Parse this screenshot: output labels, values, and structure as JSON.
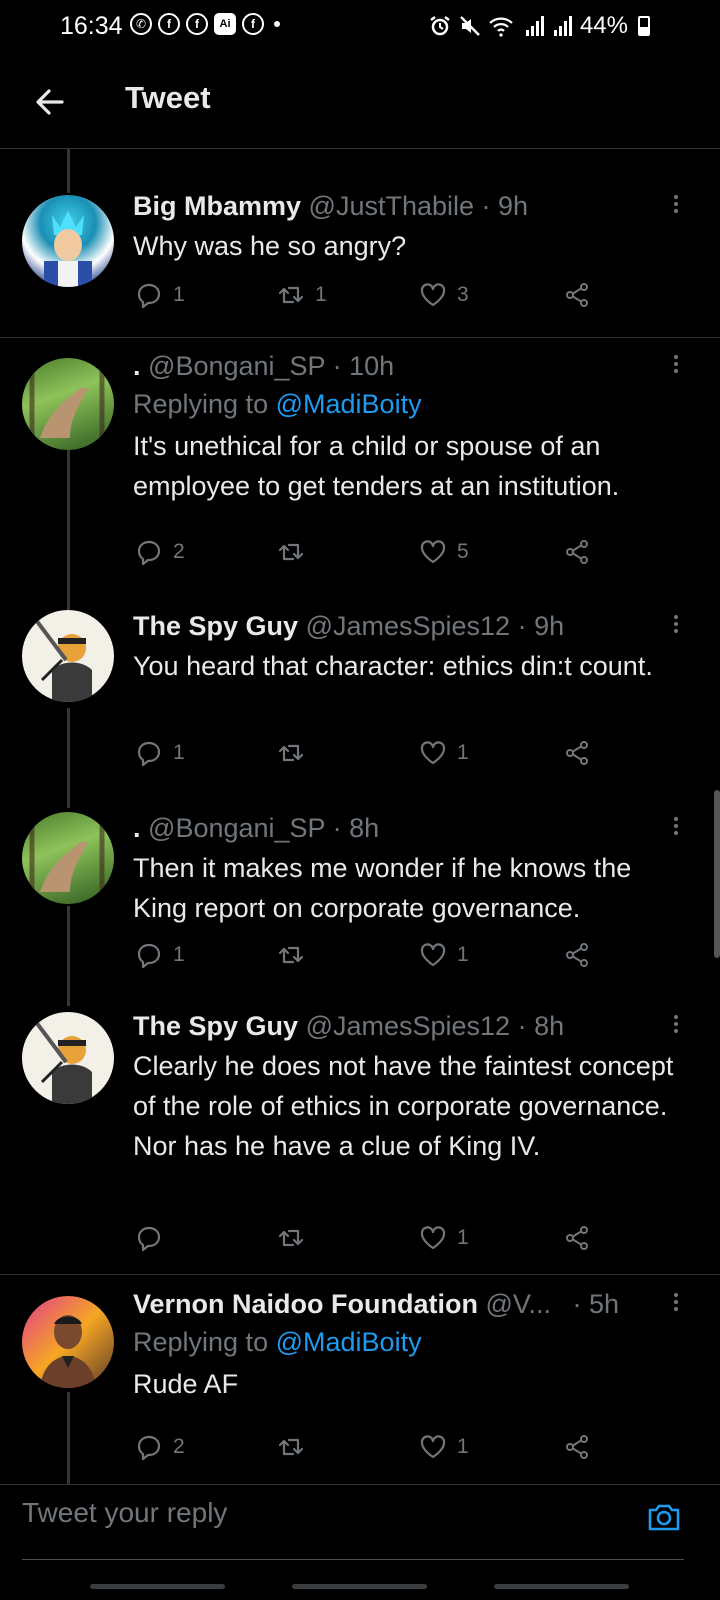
{
  "status_bar": {
    "time": "16:34",
    "app_icons": [
      "whatsapp-icon",
      "facebook-icon",
      "facebook-icon",
      "ai-icon",
      "facebook-icon"
    ],
    "ai_label": "Ai",
    "battery": "44%"
  },
  "header": {
    "title": "Tweet"
  },
  "tweets": [
    {
      "name": "Big Mbammy",
      "handle": "@JustThabile",
      "time": "· 9h",
      "reply_to_prefix": "",
      "reply_to": "",
      "text": "Why was he so angry?",
      "replies": "1",
      "retweets": "1",
      "likes": "3"
    },
    {
      "name": ".",
      "handle": "@Bongani_SP",
      "time": "· 10h",
      "reply_to_prefix": "Replying to",
      "reply_to": "@MadiBoity",
      "text": "It's unethical for a child or spouse of an employee to get tenders at an institution.",
      "replies": "2",
      "retweets": "",
      "likes": "5"
    },
    {
      "name": "The Spy Guy",
      "handle": "@JamesSpies12",
      "time": "· 9h",
      "reply_to_prefix": "",
      "reply_to": "",
      "text": "You heard that character: ethics din:t count.",
      "replies": "1",
      "retweets": "",
      "likes": "1"
    },
    {
      "name": ".",
      "handle": "@Bongani_SP",
      "time": "· 8h",
      "reply_to_prefix": "",
      "reply_to": "",
      "text": "Then it makes me wonder if he knows the King report on corporate governance.",
      "replies": "1",
      "retweets": "",
      "likes": "1"
    },
    {
      "name": "The Spy Guy",
      "handle": "@JamesSpies12",
      "time": "· 8h",
      "reply_to_prefix": "",
      "reply_to": "",
      "text": "Clearly he does not have the faintest concept of the role of ethics in corporate governance. Nor has he have a clue of King IV.",
      "replies": "",
      "retweets": "",
      "likes": "1"
    },
    {
      "name": "Vernon Naidoo Foundation",
      "handle": "@V...",
      "time": "· 5h",
      "reply_to_prefix": "Replying to",
      "reply_to": "@MadiBoity",
      "text": "Rude AF",
      "replies": "2",
      "retweets": "",
      "likes": "1"
    }
  ],
  "reply_bar": {
    "placeholder": "Tweet your reply"
  },
  "colors": {
    "accent": "#1d9bf0",
    "muted": "#71767b",
    "text": "#e7e9ea",
    "background": "#000000"
  }
}
